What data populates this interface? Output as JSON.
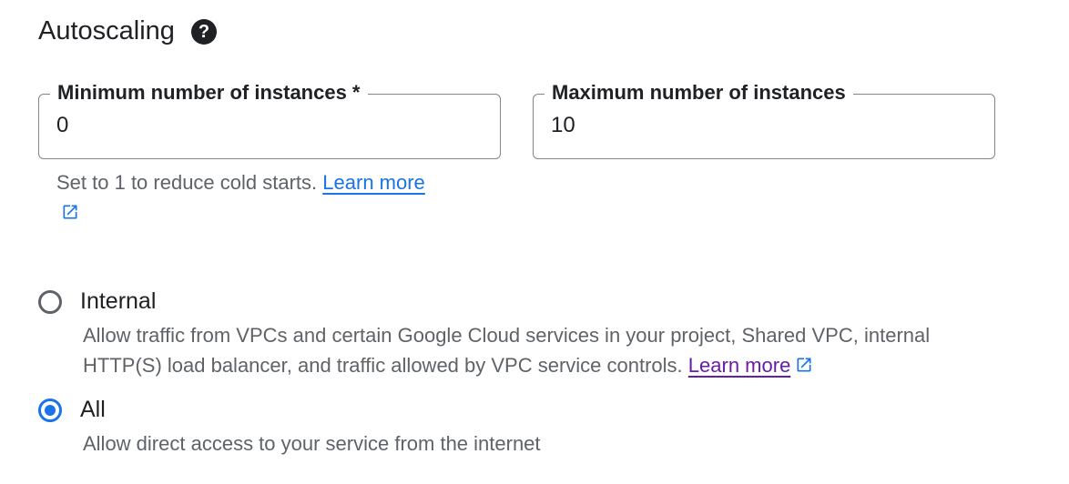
{
  "autoscaling": {
    "title": "Autoscaling",
    "help_icon": "help-circle-icon",
    "min_field": {
      "label": "Minimum number of instances *",
      "value": "0"
    },
    "max_field": {
      "label": "Maximum number of instances",
      "value": "10"
    },
    "hint_text": "Set to 1 to reduce cold starts.",
    "hint_link": "Learn more"
  },
  "ingress": {
    "options": [
      {
        "label": "Internal",
        "checked": false,
        "description": "Allow traffic from VPCs and certain Google Cloud services in your project, Shared VPC, internal HTTP(S) load balancer, and traffic allowed by VPC service controls.",
        "link": "Learn more"
      },
      {
        "label": "All",
        "checked": true,
        "description": "Allow direct access to your service from the internet"
      }
    ]
  },
  "colors": {
    "accent": "#1a73e8",
    "visited_link": "#681da8",
    "text_primary": "#202124",
    "text_secondary": "#5f6368",
    "border": "#80868b"
  }
}
